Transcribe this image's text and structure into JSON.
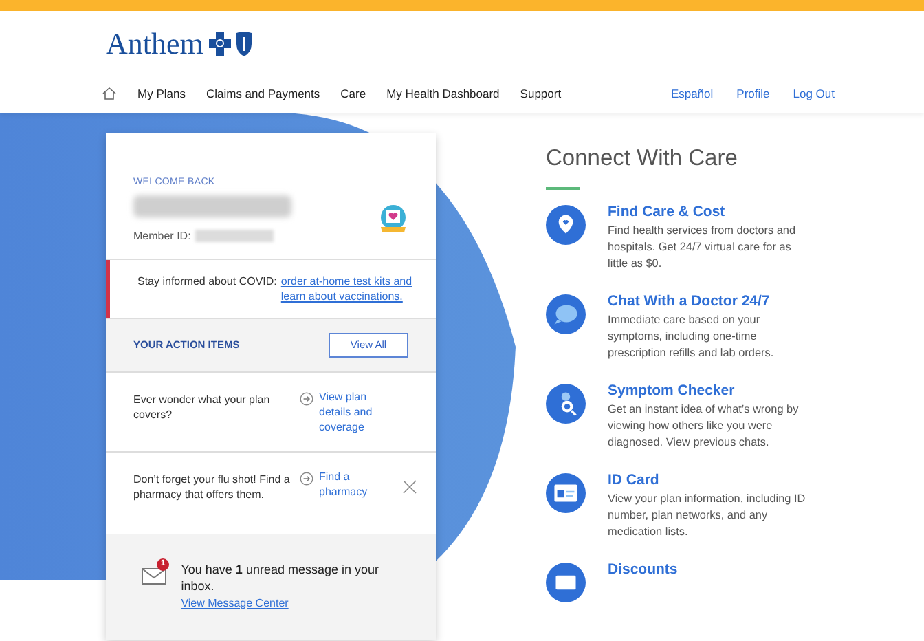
{
  "header": {
    "logo": "Anthem",
    "nav": [
      "My Plans",
      "Claims and Payments",
      "Care",
      "My Health Dashboard",
      "Support"
    ],
    "links": [
      "Español",
      "Profile",
      "Log Out"
    ]
  },
  "card": {
    "welcome": "WELCOME BACK",
    "member_id_label": "Member ID:",
    "alert": {
      "text": "Stay informed about COVID: ",
      "link": "order at-home test kits and learn about vaccinations."
    },
    "action_items": {
      "title": "YOUR ACTION ITEMS",
      "button": "View All",
      "items": [
        {
          "text": "Ever wonder what your plan covers?",
          "link": "View plan details and coverage",
          "dismissible": false
        },
        {
          "text": "Don’t forget your flu shot! Find a pharmacy that offers them.",
          "link": "Find a pharmacy",
          "dismissible": true
        }
      ]
    },
    "message": {
      "text": "You have **1** unread message in your inbox.",
      "badge": "1",
      "link": "View Message Center"
    }
  },
  "connect": {
    "title": "Connect With Care",
    "items": [
      {
        "kind": "location",
        "title": "Find Care & Cost",
        "description": "Find health services from doctors and hospitals. Get 24/7 virtual care for as little as $0."
      },
      {
        "kind": "chat",
        "title": "Chat With a Doctor 24/7",
        "description": "Immediate care based on your symptoms, including one-time prescription refills and lab orders."
      },
      {
        "kind": "search",
        "title": "Symptom Checker",
        "description": "Get an instant idea of what’s wrong by viewing how others like you were diagnosed. View previous chats."
      },
      {
        "kind": "card",
        "title": "ID Card",
        "description": "View your plan information, including ID number, plan networks, and any medication lists."
      },
      {
        "kind": "discount",
        "title": "Discounts"
      }
    ]
  }
}
